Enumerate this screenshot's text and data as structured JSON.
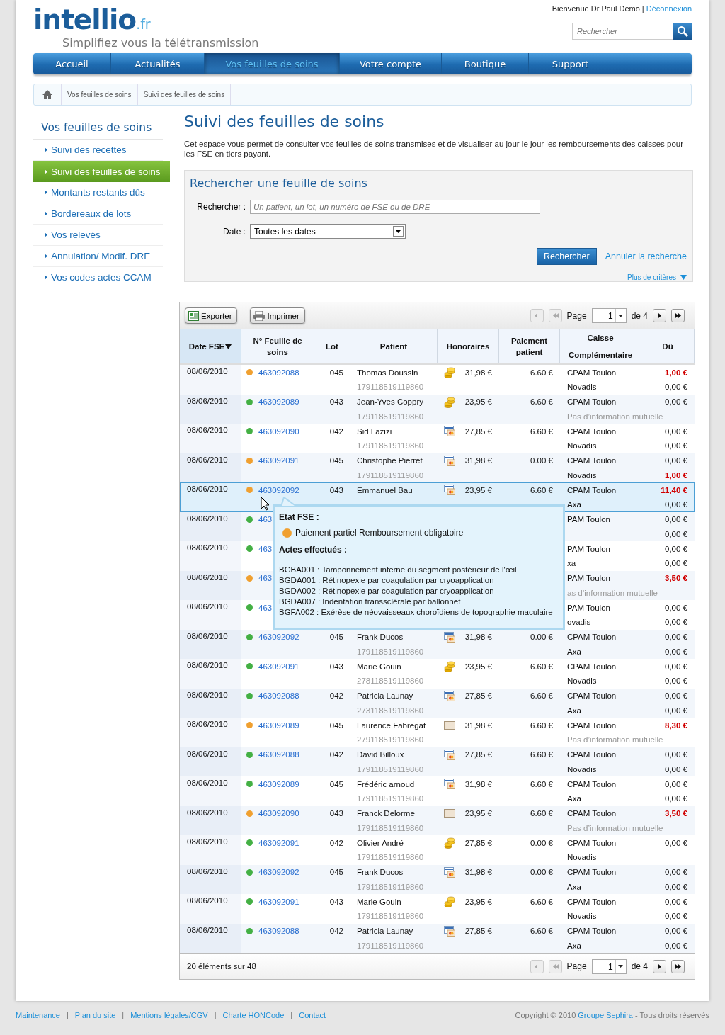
{
  "header": {
    "logo": "intellio",
    "logo_suffix": ".fr",
    "tagline": "Simplifiez vous la télétransmission",
    "welcome": "Bienvenue Dr Paul Démo",
    "separator": "|",
    "logout": "Déconnexion",
    "search": {
      "placeholder": "Rechercher"
    }
  },
  "nav": {
    "tabs": [
      {
        "label": "Accueil",
        "selected": false
      },
      {
        "label": "Actualités",
        "selected": false
      },
      {
        "label": "Vos feuilles de soins",
        "selected": true
      },
      {
        "label": "Votre compte",
        "selected": false
      },
      {
        "label": "Boutique",
        "selected": false
      },
      {
        "label": "Support",
        "selected": false
      }
    ]
  },
  "breadcrumb": [
    "Vos feuilles de soins",
    "Suivi des feuilles de soins"
  ],
  "sidebar": {
    "title": "Vos feuilles de soins",
    "items": [
      {
        "label": "Suivi des recettes",
        "selected": false
      },
      {
        "label": "Suivi des feuilles de soins",
        "selected": true
      },
      {
        "label": "Montants restants dûs",
        "selected": false
      },
      {
        "label": "Bordereaux de lots",
        "selected": false
      },
      {
        "label": "Vos relevés",
        "selected": false
      },
      {
        "label": "Annulation/ Modif. DRE",
        "selected": false
      },
      {
        "label": "Vos codes actes CCAM",
        "selected": false
      }
    ]
  },
  "page": {
    "title": "Suivi des feuilles de soins",
    "intro": "Cet espace vous permet de consulter vos feuilles de soins transmises et de visualiser au jour le jour les remboursements des caisses pour les FSE en tiers payant."
  },
  "search_panel": {
    "title": "Rechercher une feuille de soins",
    "query": {
      "label": "Rechercher :",
      "placeholder": "Un patient, un lot, un numéro de FSE ou de DRE"
    },
    "date": {
      "label": "Date :",
      "value": "Toutes les dates"
    },
    "submit": "Rechercher",
    "cancel": "Annuler la recherche",
    "more": "Plus de critères"
  },
  "table": {
    "toolbar": [
      {
        "kind": "export",
        "label": "Exporter"
      },
      {
        "kind": "print",
        "label": "Imprimer"
      }
    ],
    "pager_top": {
      "label": "Page",
      "value": "1",
      "of": "de 4",
      "buttons": [
        {
          "kind": "prev",
          "disabled": true
        },
        {
          "kind": "first",
          "disabled": true
        },
        {
          "kind": "next",
          "disabled": false
        },
        {
          "kind": "last",
          "disabled": false
        }
      ]
    },
    "columns": [
      {
        "label": "Date FSE",
        "sorted": true
      },
      {
        "label": "N° Feuille de soins",
        "sorted": false
      },
      {
        "label": "Lot",
        "sorted": false
      },
      {
        "label": "Patient",
        "sorted": false
      },
      {
        "label": "Honoraires",
        "sorted": false
      },
      {
        "label": "Paiement patient",
        "sorted": false
      },
      {
        "label": "Caisse",
        "sublabel": "Complémentaire",
        "sorted": false
      },
      {
        "label": "Dû",
        "sorted": false
      }
    ],
    "rows": [
      {
        "date": "08/06/2010",
        "color": "#f0a030",
        "number": "463092088",
        "lot": "045",
        "patient": "Thomas Doussin",
        "nir": "179118519119860",
        "kind": "coins",
        "fees": "31,98 €",
        "paid": "6.60 €",
        "selected": false,
        "lines": [
          {
            "caisse": "CPAM Toulon",
            "amount": "1,00 €",
            "alert": true,
            "muted": false
          },
          {
            "caisse": "Novadis",
            "amount": "0,00 €",
            "alert": false,
            "muted": false
          }
        ]
      },
      {
        "date": "08/06/2010",
        "color": "#44b044",
        "number": "463092089",
        "lot": "043",
        "patient": "Jean-Yves Coppry",
        "nir": "179118519119860",
        "kind": "coins",
        "fees": "23,95 €",
        "paid": "6.60 €",
        "selected": false,
        "lines": [
          {
            "caisse": "CPAM Toulon",
            "amount": "0,00 €",
            "alert": false,
            "muted": false
          },
          {
            "caisse": "Pas d’information  mutuelle",
            "muted": true
          }
        ]
      },
      {
        "date": "08/06/2010",
        "color": "#44b044",
        "number": "463092090",
        "lot": "042",
        "patient": "Sid Lazizi",
        "nir": "179118519119860",
        "kind": "card",
        "fees": "27,85 €",
        "paid": "6.60 €",
        "selected": false,
        "lines": [
          {
            "caisse": "CPAM Toulon",
            "amount": "0,00 €",
            "alert": false,
            "muted": false
          },
          {
            "caisse": "Novadis",
            "amount": "0,00 €",
            "alert": false,
            "muted": false
          }
        ]
      },
      {
        "date": "08/06/2010",
        "color": "#f0a030",
        "number": "463092091",
        "lot": "045",
        "patient": "Christophe Pierret",
        "nir": "179118519119860",
        "kind": "card",
        "fees": "31,98 €",
        "paid": "0.00 €",
        "selected": false,
        "lines": [
          {
            "caisse": "CPAM Toulon",
            "amount": "0,00 €",
            "alert": false,
            "muted": false
          },
          {
            "caisse": "Novadis",
            "amount": "1,00 €",
            "alert": true,
            "muted": false
          }
        ]
      },
      {
        "date": "08/06/2010",
        "color": "#f0a030",
        "number": "463092092",
        "lot": "043",
        "patient": "Emmanuel Bau",
        "kind": "card",
        "fees": "23,95 €",
        "paid": "6.60 €",
        "selected": true,
        "lines": [
          {
            "caisse": "CPAM Toulon",
            "amount": "11,40 €",
            "alert": true,
            "muted": false
          },
          {
            "caisse": "Axa",
            "amount": "0,00 €",
            "alert": false,
            "muted": false
          }
        ]
      },
      {
        "date": "08/06/2010",
        "color": "#44b044",
        "number": "463",
        "selected": false,
        "lines": [
          {
            "caisse": "PAM Toulon",
            "amount": "0,00 €",
            "alert": false,
            "muted": false
          },
          {
            "amount": "0,00 €",
            "alert": false
          }
        ]
      },
      {
        "date": "08/06/2010",
        "color": "#44b044",
        "number": "463",
        "selected": false,
        "lines": [
          {
            "caisse": "PAM Toulon",
            "amount": "0,00 €",
            "alert": false,
            "muted": false
          },
          {
            "caisse": "xa",
            "amount": "0,00 €",
            "alert": false,
            "muted": false
          }
        ]
      },
      {
        "date": "08/06/2010",
        "color": "#f0a030",
        "number": "463",
        "selected": false,
        "lines": [
          {
            "caisse": "PAM Toulon",
            "amount": "3,50 €",
            "alert": true,
            "muted": false
          },
          {
            "caisse": "as d’information  mutuelle",
            "muted": true
          }
        ]
      },
      {
        "date": "08/06/2010",
        "color": "#44b044",
        "number": "463",
        "selected": false,
        "lines": [
          {
            "caisse": "PAM Toulon",
            "amount": "0,00 €",
            "alert": false,
            "muted": false
          },
          {
            "caisse": "ovadis",
            "amount": "0,00 €",
            "alert": false,
            "muted": false
          }
        ]
      },
      {
        "date": "08/06/2010",
        "color": "#44b044",
        "number": "463092092",
        "lot": "045",
        "patient": "Frank Ducos",
        "nir": "179118519119860",
        "kind": "card",
        "fees": "31,98 €",
        "paid": "0.00 €",
        "selected": false,
        "lines": [
          {
            "caisse": "CPAM Toulon",
            "amount": "0,00 €",
            "alert": false,
            "muted": false
          },
          {
            "caisse": "Axa",
            "amount": "0,00 €",
            "alert": false,
            "muted": false
          }
        ]
      },
      {
        "date": "08/06/2010",
        "color": "#44b044",
        "number": "463092091",
        "lot": "043",
        "patient": "Marie Gouin",
        "nir": "278118519119860",
        "kind": "coins",
        "fees": "23,95 €",
        "paid": "6.60 €",
        "selected": false,
        "lines": [
          {
            "caisse": "CPAM Toulon",
            "amount": "0,00 €",
            "alert": false,
            "muted": false
          },
          {
            "caisse": "Novadis",
            "amount": "0,00 €",
            "alert": false,
            "muted": false
          }
        ]
      },
      {
        "date": "08/06/2010",
        "color": "#44b044",
        "number": "463092088",
        "lot": "042",
        "patient": "Patricia Launay",
        "nir": "273118519119860",
        "kind": "card",
        "fees": "27,85 €",
        "paid": "6.60 €",
        "selected": false,
        "lines": [
          {
            "caisse": "CPAM Toulon",
            "amount": "0,00 €",
            "alert": false,
            "muted": false
          },
          {
            "caisse": "Axa",
            "amount": "0,00 €",
            "alert": false,
            "muted": false
          }
        ]
      },
      {
        "date": "08/06/2010",
        "color": "#f0a030",
        "number": "463092089",
        "lot": "045",
        "patient": "Laurence Fabregat",
        "nir": "279118519119860",
        "kind": "blank",
        "fees": "31,98 €",
        "paid": "6.60 €",
        "selected": false,
        "lines": [
          {
            "caisse": "CPAM Toulon",
            "amount": "8,30 €",
            "alert": true,
            "muted": false
          },
          {
            "caisse": "Pas d’information  mutuelle",
            "muted": true
          }
        ]
      },
      {
        "date": "08/06/2010",
        "color": "#44b044",
        "number": "463092088",
        "lot": "042",
        "patient": "David Billoux",
        "nir": "179118519119860",
        "kind": "card",
        "fees": "27,85 €",
        "paid": "6.60 €",
        "selected": false,
        "lines": [
          {
            "caisse": "CPAM Toulon",
            "amount": "0,00 €",
            "alert": false,
            "muted": false
          },
          {
            "caisse": "Novadis",
            "amount": "0,00 €",
            "alert": false,
            "muted": false
          }
        ]
      },
      {
        "date": "08/06/2010",
        "color": "#44b044",
        "number": "463092089",
        "lot": "045",
        "patient": "Frédéric arnoud",
        "nir": "179118519119860",
        "kind": "card",
        "fees": "31,98 €",
        "paid": "6.60 €",
        "selected": false,
        "lines": [
          {
            "caisse": "CPAM Toulon",
            "amount": "0,00 €",
            "alert": false,
            "muted": false
          },
          {
            "caisse": "Axa",
            "amount": "0,00 €",
            "alert": false,
            "muted": false
          }
        ]
      },
      {
        "date": "08/06/2010",
        "color": "#f0a030",
        "number": "463092090",
        "lot": "043",
        "patient": "Franck Delorme",
        "nir": "179118519119860",
        "kind": "blank",
        "fees": "23,95 €",
        "paid": "6.60 €",
        "selected": false,
        "lines": [
          {
            "caisse": "CPAM Toulon",
            "amount": "3,50 €",
            "alert": true,
            "muted": false
          },
          {
            "caisse": "Pas d’information  mutuelle",
            "muted": true
          }
        ]
      },
      {
        "date": "08/06/2010",
        "color": "#44b044",
        "number": "463092091",
        "lot": "042",
        "patient": "Olivier André",
        "nir": "179118519119860",
        "kind": "coins",
        "fees": "27,85 €",
        "paid": "0.00 €",
        "selected": false,
        "lines": [
          {
            "caisse": "CPAM Toulon",
            "amount": "0,00 €",
            "alert": false,
            "muted": false
          },
          {
            "caisse": "Novadis",
            "muted": false
          }
        ]
      },
      {
        "date": "08/06/2010",
        "color": "#44b044",
        "number": "463092092",
        "lot": "045",
        "patient": "Frank Ducos",
        "nir": "179118519119860",
        "kind": "card",
        "fees": "31,98 €",
        "paid": "0.00 €",
        "selected": false,
        "lines": [
          {
            "caisse": "CPAM Toulon",
            "amount": "0,00 €",
            "alert": false,
            "muted": false
          },
          {
            "caisse": "Axa",
            "amount": "0,00 €",
            "alert": false,
            "muted": false
          }
        ]
      },
      {
        "date": "08/06/2010",
        "color": "#44b044",
        "number": "463092091",
        "lot": "043",
        "patient": "Marie Gouin",
        "nir": "179118519119860",
        "kind": "coins",
        "fees": "23,95 €",
        "paid": "6.60 €",
        "selected": false,
        "lines": [
          {
            "caisse": "CPAM Toulon",
            "amount": "0,00 €",
            "alert": false,
            "muted": false
          },
          {
            "caisse": "Novadis",
            "amount": "0,00 €",
            "alert": false,
            "muted": false
          }
        ]
      },
      {
        "date": "08/06/2010",
        "color": "#44b044",
        "number": "463092088",
        "lot": "042",
        "patient": "Patricia Launay",
        "nir": "179118519119860",
        "kind": "card",
        "fees": "27,85 €",
        "paid": "6.60 €",
        "selected": false,
        "lines": [
          {
            "caisse": "CPAM Toulon",
            "amount": "0,00 €",
            "alert": false,
            "muted": false
          },
          {
            "caisse": "Axa",
            "amount": "0,00 €",
            "alert": false,
            "muted": false
          }
        ]
      }
    ],
    "tooltip": {
      "state_title": "Etat FSE :",
      "state": {
        "color": "#f0a030",
        "text": "Paiement partiel Remboursement obligatoire"
      },
      "acts_title": "Actes effectués :",
      "acts": [
        "BGBA001 : Tamponnement interne du segment postérieur de l'œil",
        "BGDA001 : Rétinopexie par coagulation par cryoapplication",
        "BGDA002 : Rétinopexie par coagulation par cryoapplication",
        "BGDA007 : Indentation transsclérale par ballonnet",
        "BGFA002 : Exérèse de néovaisseaux choroïdiens de topographie maculaire"
      ]
    },
    "count": "20 éléments sur 48",
    "pager_bottom": {
      "label": "Page",
      "value": "1",
      "of": "de 4",
      "buttons": [
        {
          "kind": "prev",
          "disabled": true
        },
        {
          "kind": "first",
          "disabled": true
        },
        {
          "kind": "next",
          "disabled": false
        },
        {
          "kind": "last",
          "disabled": false
        }
      ]
    }
  },
  "footer": {
    "links": [
      {
        "label": "Maintenance",
        "separator": "|"
      },
      {
        "label": "Plan du site",
        "separator": "|"
      },
      {
        "label": "Mentions légales/CGV",
        "separator": "|"
      },
      {
        "label": "Charte HONCode",
        "separator": "|"
      },
      {
        "label": "Contact"
      }
    ],
    "copyright_prefix": "Copyright © 2010",
    "company": "Groupe Sephira",
    "copyright_suffix": "- Tous droits réservés"
  }
}
